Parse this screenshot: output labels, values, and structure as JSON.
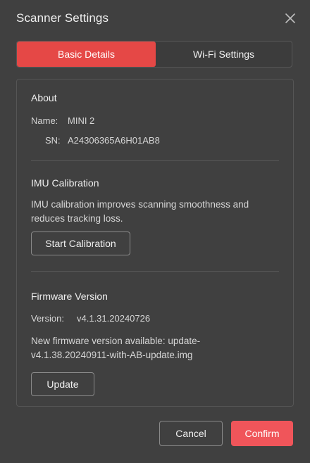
{
  "dialog": {
    "title": "Scanner Settings",
    "close_icon": "close-icon"
  },
  "tabs": [
    {
      "label": "Basic Details",
      "active": true
    },
    {
      "label": "Wi-Fi Settings",
      "active": false
    }
  ],
  "about": {
    "heading": "About",
    "name_label": "Name:",
    "name_value": "MINI 2",
    "sn_label": "SN:",
    "sn_value": "A24306365A6H01AB8"
  },
  "imu": {
    "heading": "IMU Calibration",
    "description_line1": "IMU calibration improves scanning smoothness and",
    "description_line2": "reduces tracking loss.",
    "button_label": "Start Calibration"
  },
  "firmware": {
    "heading": "Firmware Version",
    "version_label": "Version:",
    "version_value": "v4.1.31.20240726",
    "update_notice_line1": "New firmware version available: update-",
    "update_notice_line2": "v4.1.38.20240911-with-AB-update.img",
    "button_label": "Update"
  },
  "footer": {
    "cancel_label": "Cancel",
    "confirm_label": "Confirm"
  },
  "colors": {
    "accent": "#e54846",
    "confirm": "#f0555a",
    "background": "#404040"
  }
}
